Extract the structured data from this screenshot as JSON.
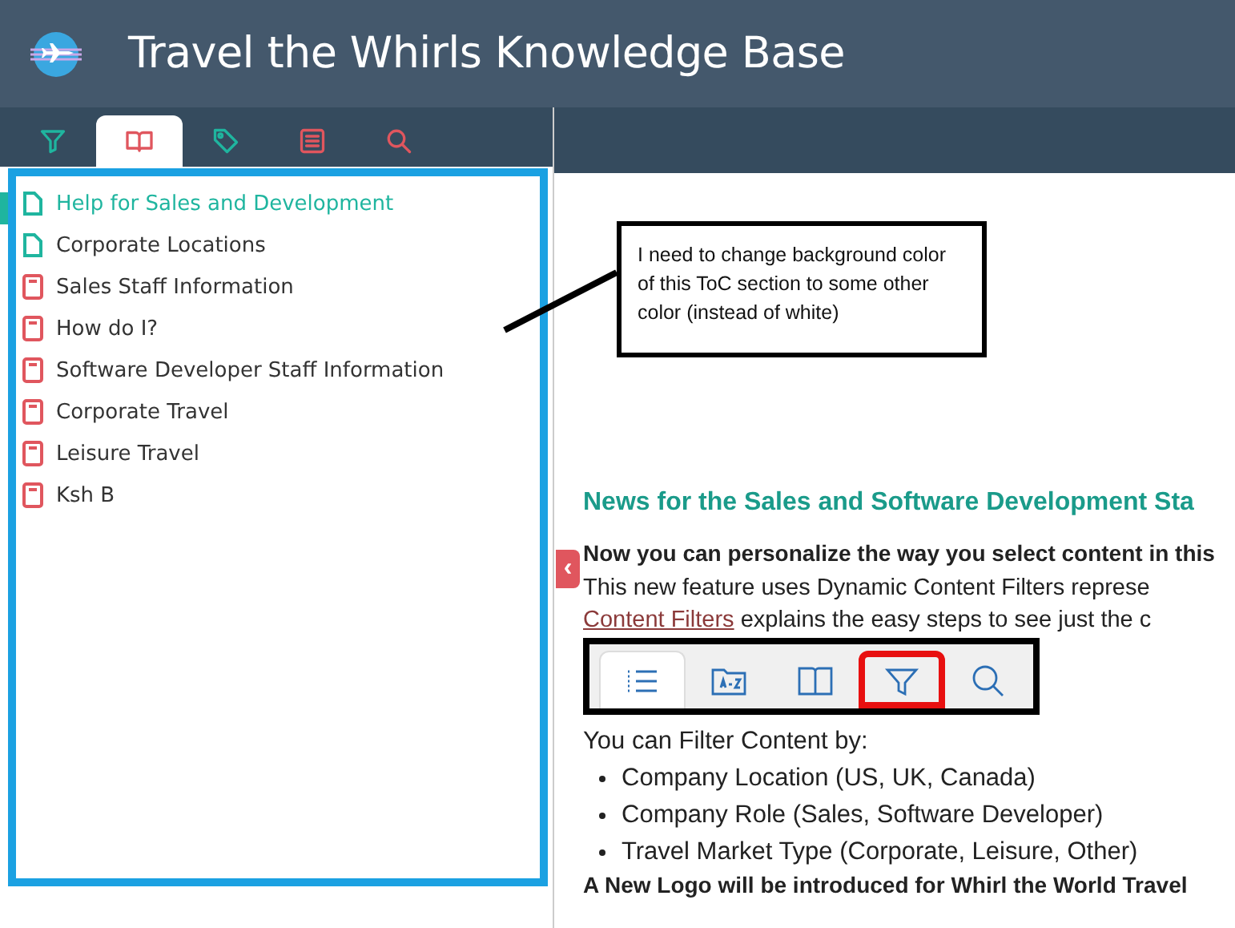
{
  "header": {
    "title": "Travel the Whirls Knowledge Base"
  },
  "nav_tabs": [
    {
      "kind": "filter",
      "selected": false
    },
    {
      "kind": "book",
      "selected": true
    },
    {
      "kind": "tag",
      "selected": false
    },
    {
      "kind": "list",
      "selected": false
    },
    {
      "kind": "search",
      "selected": false
    }
  ],
  "toc": [
    {
      "label": "Help for Sales and Development",
      "kind": "page",
      "selected": true
    },
    {
      "label": "Corporate Locations",
      "kind": "page",
      "selected": false
    },
    {
      "label": "Sales Staff Information",
      "kind": "book",
      "selected": false
    },
    {
      "label": "How do I?",
      "kind": "book",
      "selected": false
    },
    {
      "label": "Software Developer Staff Information",
      "kind": "book",
      "selected": false
    },
    {
      "label": "Corporate Travel",
      "kind": "book",
      "selected": false
    },
    {
      "label": "Leisure Travel",
      "kind": "book",
      "selected": false
    },
    {
      "label": "Ksh B",
      "kind": "book",
      "selected": false
    }
  ],
  "callout": {
    "text": "I need to change background color of this ToC section to some other color (instead of white)"
  },
  "collapse_button": "‹",
  "article": {
    "heading": "News for the Sales and Software Development Sta",
    "lead": "Now you can personalize the way you select content in this",
    "line_1": "This new feature uses Dynamic Content Filters represe",
    "link": "Content Filters",
    "line_2": "explains the easy steps to see just the c",
    "toolbar": [
      {
        "kind": "list",
        "selected": true,
        "highlighted": false
      },
      {
        "kind": "az",
        "selected": false,
        "highlighted": false
      },
      {
        "kind": "book",
        "selected": false,
        "highlighted": false
      },
      {
        "kind": "filter",
        "selected": false,
        "highlighted": true
      },
      {
        "kind": "search",
        "selected": false,
        "highlighted": false
      }
    ],
    "filter_intro": "You can Filter Content by:",
    "bullets": [
      "Company Location (US, UK, Canada)",
      "Company Role (Sales, Software Developer)",
      "Travel Market Type (Corporate, Leisure, Other)"
    ],
    "footer_line": "A New Logo will be introduced for Whirl the World Travel"
  }
}
